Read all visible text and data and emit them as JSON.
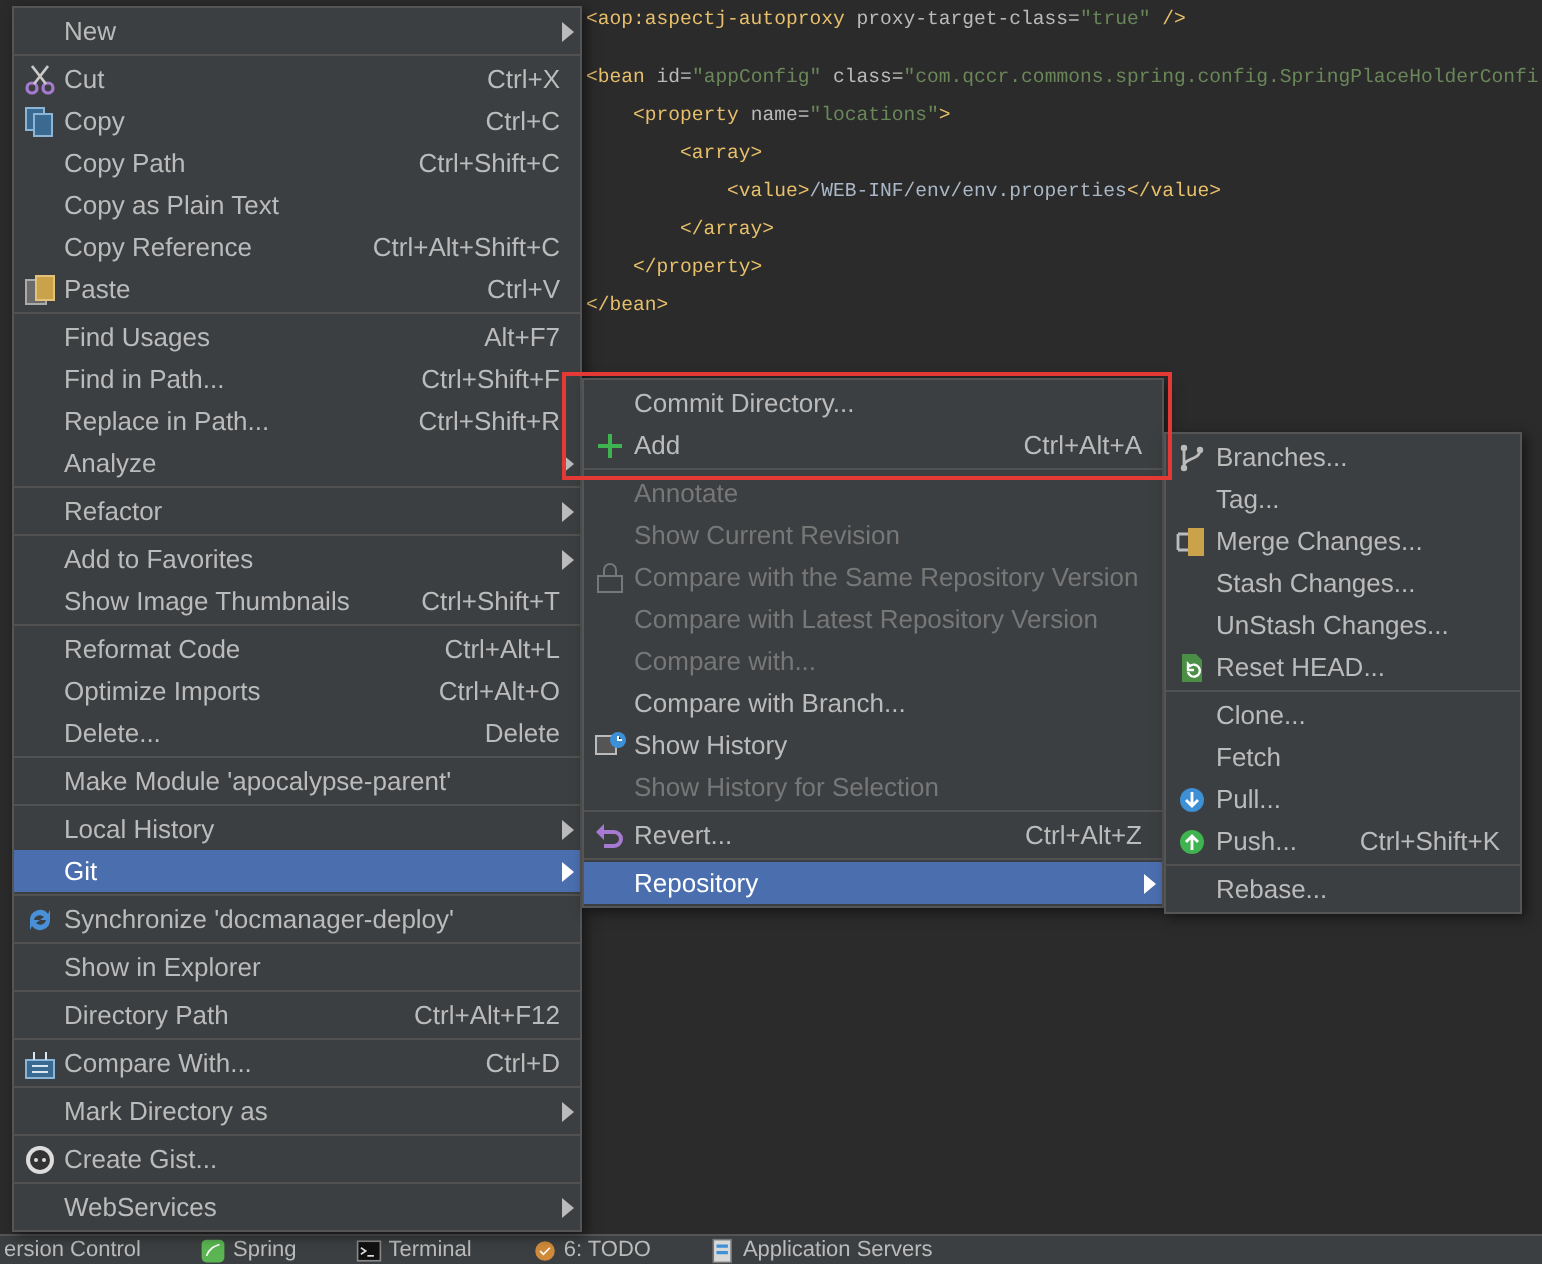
{
  "editor": {
    "blocks": [
      [
        {
          "tokens": [
            {
              "kind": "tag",
              "text": "<aop:aspectj-autoproxy"
            },
            {
              "kind": "attr",
              "text": " proxy-target-class="
            },
            {
              "kind": "str",
              "text": "\"true\""
            },
            {
              "kind": "tag",
              "text": " />"
            }
          ]
        }
      ],
      [
        {
          "tokens": [
            {
              "kind": "tag",
              "text": "<bean"
            },
            {
              "kind": "attr",
              "text": " id="
            },
            {
              "kind": "str",
              "text": "\"appConfig\""
            },
            {
              "kind": "attr",
              "text": " class="
            },
            {
              "kind": "str",
              "text": "\"com.qccr.commons.spring.config.SpringPlaceHolderConfi"
            }
          ]
        },
        {
          "tokens": [
            {
              "kind": "tag",
              "text": "    <property"
            },
            {
              "kind": "attr",
              "text": " name="
            },
            {
              "kind": "str",
              "text": "\"locations\""
            },
            {
              "kind": "tag",
              "text": ">"
            }
          ]
        },
        {
          "tokens": [
            {
              "kind": "tag",
              "text": "        <array>"
            }
          ]
        },
        {
          "tokens": [
            {
              "kind": "tag",
              "text": "            <value>"
            },
            {
              "kind": "text",
              "text": "/WEB-INF/env/env.properties"
            },
            {
              "kind": "tag",
              "text": "</value>"
            }
          ]
        },
        {
          "tokens": [
            {
              "kind": "tag",
              "text": "        </array>"
            }
          ]
        },
        {
          "tokens": [
            {
              "kind": "tag",
              "text": "    </property>"
            }
          ]
        },
        {
          "tokens": [
            {
              "kind": "tag",
              "text": "</bean>"
            }
          ]
        }
      ]
    ]
  },
  "context_menu": {
    "groups": [
      [
        {
          "label": "New",
          "submenu": true,
          "disabled": false,
          "selected": false
        }
      ],
      [
        {
          "label": "Cut",
          "shortcut": "Ctrl+X",
          "submenu": false,
          "disabled": false,
          "selected": false,
          "kind": "cut"
        },
        {
          "label": "Copy",
          "shortcut": "Ctrl+C",
          "submenu": false,
          "disabled": false,
          "selected": false,
          "kind": "copy"
        },
        {
          "label": "Copy Path",
          "shortcut": "Ctrl+Shift+C",
          "submenu": false,
          "disabled": false,
          "selected": false
        },
        {
          "label": "Copy as Plain Text",
          "submenu": false,
          "disabled": false,
          "selected": false
        },
        {
          "label": "Copy Reference",
          "shortcut": "Ctrl+Alt+Shift+C",
          "submenu": false,
          "disabled": false,
          "selected": false
        },
        {
          "label": "Paste",
          "shortcut": "Ctrl+V",
          "submenu": false,
          "disabled": false,
          "selected": false,
          "kind": "paste"
        }
      ],
      [
        {
          "label": "Find Usages",
          "shortcut": "Alt+F7",
          "submenu": false,
          "disabled": false,
          "selected": false
        },
        {
          "label": "Find in Path...",
          "shortcut": "Ctrl+Shift+F",
          "submenu": false,
          "disabled": false,
          "selected": false
        },
        {
          "label": "Replace in Path...",
          "shortcut": "Ctrl+Shift+R",
          "submenu": false,
          "disabled": false,
          "selected": false
        },
        {
          "label": "Analyze",
          "submenu": true,
          "disabled": false,
          "selected": false
        }
      ],
      [
        {
          "label": "Refactor",
          "submenu": true,
          "disabled": false,
          "selected": false
        }
      ],
      [
        {
          "label": "Add to Favorites",
          "submenu": true,
          "disabled": false,
          "selected": false
        },
        {
          "label": "Show Image Thumbnails",
          "shortcut": "Ctrl+Shift+T",
          "submenu": false,
          "disabled": false,
          "selected": false
        }
      ],
      [
        {
          "label": "Reformat Code",
          "shortcut": "Ctrl+Alt+L",
          "submenu": false,
          "disabled": false,
          "selected": false
        },
        {
          "label": "Optimize Imports",
          "shortcut": "Ctrl+Alt+O",
          "submenu": false,
          "disabled": false,
          "selected": false
        },
        {
          "label": "Delete...",
          "shortcut": "Delete",
          "submenu": false,
          "disabled": false,
          "selected": false
        }
      ],
      [
        {
          "label": "Make Module 'apocalypse-parent'",
          "submenu": false,
          "disabled": false,
          "selected": false
        }
      ],
      [
        {
          "label": "Local History",
          "submenu": true,
          "disabled": false,
          "selected": false
        },
        {
          "label": "Git",
          "submenu": true,
          "disabled": false,
          "selected": true
        }
      ],
      [
        {
          "label": "Synchronize 'docmanager-deploy'",
          "submenu": false,
          "disabled": false,
          "selected": false,
          "kind": "sync"
        }
      ],
      [
        {
          "label": "Show in Explorer",
          "submenu": false,
          "disabled": false,
          "selected": false
        }
      ],
      [
        {
          "label": "Directory Path",
          "shortcut": "Ctrl+Alt+F12",
          "submenu": false,
          "disabled": false,
          "selected": false
        }
      ],
      [
        {
          "label": "Compare With...",
          "shortcut": "Ctrl+D",
          "submenu": false,
          "disabled": false,
          "selected": false,
          "kind": "compare"
        }
      ],
      [
        {
          "label": "Mark Directory as",
          "submenu": true,
          "disabled": false,
          "selected": false
        }
      ],
      [
        {
          "label": "Create Gist...",
          "submenu": false,
          "disabled": false,
          "selected": false,
          "kind": "gist"
        }
      ],
      [
        {
          "label": "WebServices",
          "submenu": true,
          "disabled": false,
          "selected": false
        }
      ]
    ]
  },
  "git_submenu": {
    "groups": [
      [
        {
          "label": "Commit Directory...",
          "submenu": false,
          "disabled": false,
          "selected": false
        },
        {
          "label": "Add",
          "shortcut": "Ctrl+Alt+A",
          "submenu": false,
          "disabled": false,
          "selected": false,
          "kind": "add"
        }
      ],
      [
        {
          "label": "Annotate",
          "submenu": false,
          "disabled": true,
          "selected": false
        },
        {
          "label": "Show Current Revision",
          "submenu": false,
          "disabled": true,
          "selected": false
        },
        {
          "label": "Compare with the Same Repository Version",
          "submenu": false,
          "disabled": true,
          "selected": false,
          "kind": "lock"
        },
        {
          "label": "Compare with Latest Repository Version",
          "submenu": false,
          "disabled": true,
          "selected": false
        },
        {
          "label": "Compare with...",
          "submenu": false,
          "disabled": true,
          "selected": false
        },
        {
          "label": "Compare with Branch...",
          "submenu": false,
          "disabled": false,
          "selected": false
        },
        {
          "label": "Show History",
          "submenu": false,
          "disabled": false,
          "selected": false,
          "kind": "history"
        },
        {
          "label": "Show History for Selection",
          "submenu": false,
          "disabled": true,
          "selected": false
        }
      ],
      [
        {
          "label": "Revert...",
          "shortcut": "Ctrl+Alt+Z",
          "submenu": false,
          "disabled": false,
          "selected": false,
          "kind": "revert"
        }
      ],
      [
        {
          "label": "Repository",
          "submenu": true,
          "disabled": false,
          "selected": true
        }
      ]
    ]
  },
  "repository_submenu": {
    "groups": [
      [
        {
          "label": "Branches...",
          "submenu": false,
          "disabled": false,
          "selected": false,
          "kind": "branches"
        },
        {
          "label": "Tag...",
          "submenu": false,
          "disabled": false,
          "selected": false
        },
        {
          "label": "Merge Changes...",
          "submenu": false,
          "disabled": false,
          "selected": false,
          "kind": "merge"
        },
        {
          "label": "Stash Changes...",
          "submenu": false,
          "disabled": false,
          "selected": false
        },
        {
          "label": "UnStash Changes...",
          "submenu": false,
          "disabled": false,
          "selected": false
        },
        {
          "label": "Reset HEAD...",
          "submenu": false,
          "disabled": false,
          "selected": false,
          "kind": "reset"
        }
      ],
      [
        {
          "label": "Clone...",
          "submenu": false,
          "disabled": false,
          "selected": false
        },
        {
          "label": "Fetch",
          "submenu": false,
          "disabled": false,
          "selected": false
        },
        {
          "label": "Pull...",
          "submenu": false,
          "disabled": false,
          "selected": false,
          "kind": "pull"
        },
        {
          "label": "Push...",
          "shortcut": "Ctrl+Shift+K",
          "submenu": false,
          "disabled": false,
          "selected": false,
          "kind": "push"
        }
      ],
      [
        {
          "label": "Rebase...",
          "submenu": false,
          "disabled": false,
          "selected": false
        }
      ]
    ]
  },
  "tool_bar": [
    {
      "label": "ersion Control"
    },
    {
      "label": "Spring",
      "kind": "spring"
    },
    {
      "label": "Terminal",
      "kind": "terminal"
    },
    {
      "label": "6: TODO",
      "kind": "todo"
    },
    {
      "label": "Application Servers",
      "kind": "servers"
    }
  ]
}
